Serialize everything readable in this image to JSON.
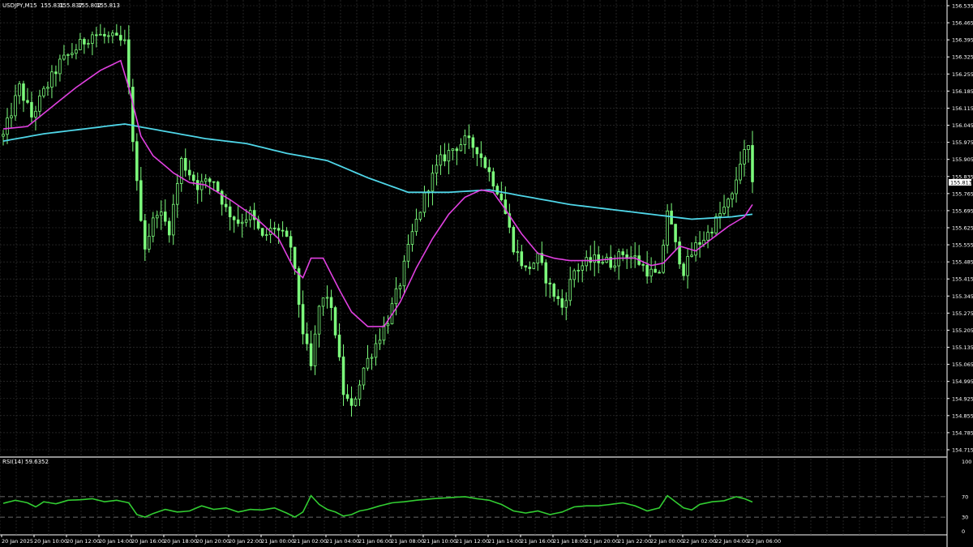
{
  "header": {
    "symbol": "USDJPY,M15",
    "open": "155.831",
    "high": "155.837",
    "low": "155.802",
    "close": "155.813"
  },
  "current_price_label": "155.813",
  "rsi_header": {
    "name": "RSI(14)",
    "value": "59.6352"
  },
  "colors": {
    "background": "#000000",
    "grid": "#3a3a3a",
    "candle": "#7CFC7C",
    "ma_fast": "#E040E0",
    "ma_slow": "#4FD6E8",
    "rsi_line": "#32CD32"
  },
  "chart_data": {
    "type": "candlestick",
    "price_axis_ticks": [
      "156.535",
      "156.465",
      "156.395",
      "156.325",
      "156.255",
      "156.185",
      "156.115",
      "156.045",
      "155.975",
      "155.905",
      "155.835",
      "155.765",
      "155.695",
      "155.625",
      "155.555",
      "155.485",
      "155.415",
      "155.345",
      "155.275",
      "155.205",
      "155.135",
      "155.065",
      "154.995",
      "154.925",
      "154.855",
      "154.785",
      "154.715"
    ],
    "ylim": [
      154.705,
      156.545
    ],
    "time_axis_ticks": [
      "20 Jan 2025",
      "20 Jan 10:00",
      "20 Jan 12:00",
      "20 Jan 14:00",
      "20 Jan 16:00",
      "20 Jan 18:00",
      "20 Jan 20:00",
      "20 Jan 22:00",
      "21 Jan 00:00",
      "21 Jan 02:00",
      "21 Jan 04:00",
      "21 Jan 06:00",
      "21 Jan 08:00",
      "21 Jan 10:00",
      "21 Jan 12:00",
      "21 Jan 14:00",
      "21 Jan 16:00",
      "21 Jan 18:00",
      "21 Jan 20:00",
      "21 Jan 22:00",
      "22 Jan 00:00",
      "22 Jan 02:00",
      "22 Jan 04:00",
      "22 Jan 06:00"
    ],
    "price_keypoints": [
      [
        0,
        156.0
      ],
      [
        4,
        156.2
      ],
      [
        7,
        156.08
      ],
      [
        10,
        156.18
      ],
      [
        14,
        156.3
      ],
      [
        18,
        156.36
      ],
      [
        22,
        156.42
      ],
      [
        27,
        156.4
      ],
      [
        30,
        156.38
      ],
      [
        33,
        155.8
      ],
      [
        35,
        155.55
      ],
      [
        38,
        155.7
      ],
      [
        41,
        155.62
      ],
      [
        44,
        155.9
      ],
      [
        48,
        155.8
      ],
      [
        52,
        155.82
      ],
      [
        55,
        155.7
      ],
      [
        58,
        155.65
      ],
      [
        61,
        155.68
      ],
      [
        64,
        155.58
      ],
      [
        67,
        155.63
      ],
      [
        71,
        155.55
      ],
      [
        74,
        155.2
      ],
      [
        76,
        155.05
      ],
      [
        78,
        155.3
      ],
      [
        80,
        155.35
      ],
      [
        82,
        155.2
      ],
      [
        84,
        154.95
      ],
      [
        86,
        154.88
      ],
      [
        89,
        155.05
      ],
      [
        92,
        155.15
      ],
      [
        95,
        155.25
      ],
      [
        98,
        155.4
      ],
      [
        101,
        155.6
      ],
      [
        105,
        155.8
      ],
      [
        108,
        155.9
      ],
      [
        111,
        155.95
      ],
      [
        114,
        155.98
      ],
      [
        117,
        155.95
      ],
      [
        120,
        155.85
      ],
      [
        123,
        155.75
      ],
      [
        126,
        155.55
      ],
      [
        129,
        155.45
      ],
      [
        132,
        155.5
      ],
      [
        135,
        155.38
      ],
      [
        138,
        155.3
      ],
      [
        141,
        155.45
      ],
      [
        144,
        155.48
      ],
      [
        147,
        155.5
      ],
      [
        150,
        155.48
      ],
      [
        153,
        155.52
      ],
      [
        156,
        155.5
      ],
      [
        159,
        155.45
      ],
      [
        162,
        155.42
      ],
      [
        164,
        155.7
      ],
      [
        166,
        155.55
      ],
      [
        168,
        155.45
      ],
      [
        171,
        155.55
      ],
      [
        174,
        155.6
      ],
      [
        177,
        155.68
      ],
      [
        180,
        155.75
      ],
      [
        182,
        155.9
      ],
      [
        184,
        155.95
      ],
      [
        185,
        155.813
      ]
    ],
    "ma_fast_points": [
      [
        0,
        156.03
      ],
      [
        6,
        156.04
      ],
      [
        12,
        156.12
      ],
      [
        18,
        156.2
      ],
      [
        24,
        156.27
      ],
      [
        29,
        156.31
      ],
      [
        31,
        156.2
      ],
      [
        34,
        156.0
      ],
      [
        37,
        155.92
      ],
      [
        42,
        155.85
      ],
      [
        46,
        155.81
      ],
      [
        50,
        155.8
      ],
      [
        56,
        155.74
      ],
      [
        62,
        155.67
      ],
      [
        68,
        155.58
      ],
      [
        72,
        155.45
      ],
      [
        74,
        155.42
      ],
      [
        76,
        155.5
      ],
      [
        79,
        155.5
      ],
      [
        83,
        155.37
      ],
      [
        86,
        155.28
      ],
      [
        90,
        155.22
      ],
      [
        94,
        155.22
      ],
      [
        98,
        155.32
      ],
      [
        102,
        155.46
      ],
      [
        106,
        155.58
      ],
      [
        110,
        155.68
      ],
      [
        114,
        155.75
      ],
      [
        118,
        155.78
      ],
      [
        121,
        155.77
      ],
      [
        124,
        155.7
      ],
      [
        128,
        155.6
      ],
      [
        132,
        155.52
      ],
      [
        136,
        155.5
      ],
      [
        140,
        155.49
      ],
      [
        146,
        155.49
      ],
      [
        152,
        155.5
      ],
      [
        156,
        155.5
      ],
      [
        160,
        155.47
      ],
      [
        163,
        155.48
      ],
      [
        167,
        155.55
      ],
      [
        171,
        155.53
      ],
      [
        175,
        155.58
      ],
      [
        179,
        155.63
      ],
      [
        183,
        155.67
      ],
      [
        185,
        155.72
      ]
    ],
    "ma_slow_points": [
      [
        0,
        155.98
      ],
      [
        10,
        156.01
      ],
      [
        20,
        156.03
      ],
      [
        30,
        156.05
      ],
      [
        40,
        156.02
      ],
      [
        50,
        155.99
      ],
      [
        60,
        155.97
      ],
      [
        70,
        155.93
      ],
      [
        80,
        155.9
      ],
      [
        90,
        155.83
      ],
      [
        100,
        155.77
      ],
      [
        110,
        155.77
      ],
      [
        120,
        155.78
      ],
      [
        130,
        155.75
      ],
      [
        140,
        155.72
      ],
      [
        150,
        155.7
      ],
      [
        160,
        155.68
      ],
      [
        170,
        155.66
      ],
      [
        180,
        155.67
      ],
      [
        185,
        155.68
      ]
    ],
    "candle_count": 186,
    "rsi": {
      "levels": [
        "100",
        "70",
        "30",
        "0"
      ],
      "ylim": [
        0,
        100
      ],
      "values": [
        [
          0,
          57
        ],
        [
          3,
          63
        ],
        [
          6,
          58
        ],
        [
          8,
          50
        ],
        [
          10,
          60
        ],
        [
          13,
          56
        ],
        [
          16,
          63
        ],
        [
          19,
          64
        ],
        [
          22,
          66
        ],
        [
          25,
          60
        ],
        [
          28,
          63
        ],
        [
          31,
          58
        ],
        [
          33,
          35
        ],
        [
          35,
          30
        ],
        [
          37,
          37
        ],
        [
          40,
          45
        ],
        [
          43,
          40
        ],
        [
          46,
          42
        ],
        [
          49,
          52
        ],
        [
          52,
          45
        ],
        [
          55,
          48
        ],
        [
          58,
          40
        ],
        [
          61,
          45
        ],
        [
          64,
          44
        ],
        [
          67,
          48
        ],
        [
          70,
          38
        ],
        [
          72,
          30
        ],
        [
          74,
          40
        ],
        [
          76,
          72
        ],
        [
          78,
          55
        ],
        [
          80,
          45
        ],
        [
          82,
          40
        ],
        [
          84,
          32
        ],
        [
          86,
          35
        ],
        [
          88,
          42
        ],
        [
          90,
          45
        ],
        [
          93,
          52
        ],
        [
          96,
          58
        ],
        [
          99,
          60
        ],
        [
          102,
          63
        ],
        [
          106,
          66
        ],
        [
          110,
          68
        ],
        [
          114,
          70
        ],
        [
          117,
          66
        ],
        [
          120,
          63
        ],
        [
          123,
          55
        ],
        [
          126,
          42
        ],
        [
          129,
          38
        ],
        [
          132,
          42
        ],
        [
          135,
          35
        ],
        [
          138,
          40
        ],
        [
          141,
          50
        ],
        [
          144,
          52
        ],
        [
          147,
          52
        ],
        [
          150,
          55
        ],
        [
          153,
          58
        ],
        [
          156,
          52
        ],
        [
          159,
          42
        ],
        [
          162,
          48
        ],
        [
          164,
          72
        ],
        [
          166,
          60
        ],
        [
          168,
          48
        ],
        [
          170,
          44
        ],
        [
          172,
          55
        ],
        [
          175,
          60
        ],
        [
          178,
          62
        ],
        [
          181,
          70
        ],
        [
          183,
          66
        ],
        [
          185,
          59.6
        ]
      ]
    }
  }
}
